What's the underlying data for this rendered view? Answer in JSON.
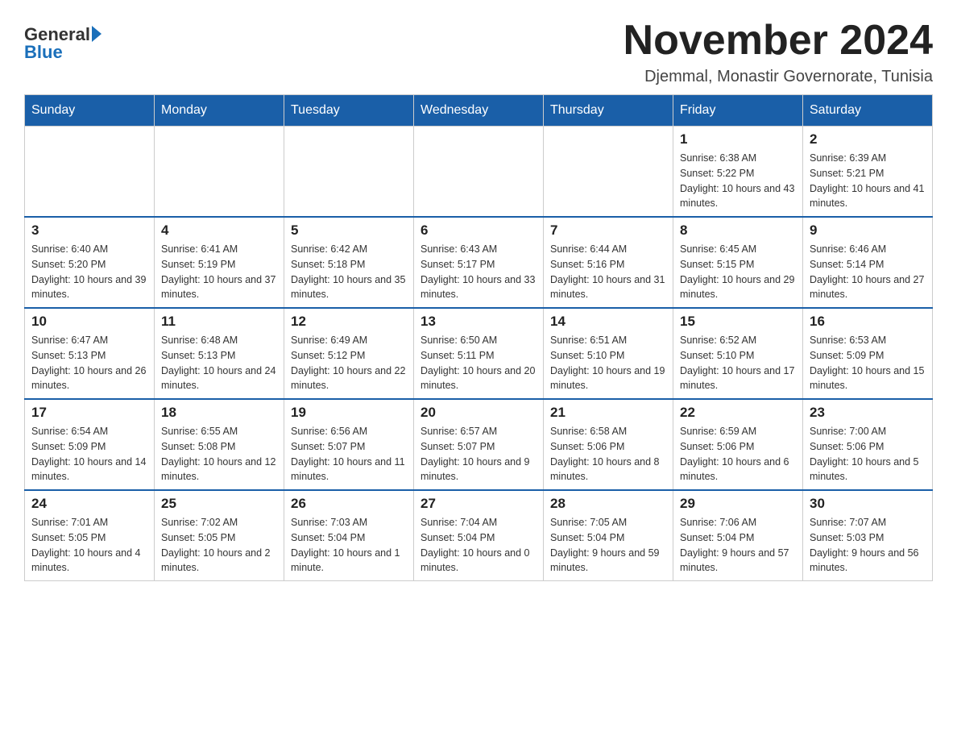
{
  "header": {
    "logo_general": "General",
    "logo_blue": "Blue",
    "title": "November 2024",
    "subtitle": "Djemmal, Monastir Governorate, Tunisia"
  },
  "weekdays": [
    "Sunday",
    "Monday",
    "Tuesday",
    "Wednesday",
    "Thursday",
    "Friday",
    "Saturday"
  ],
  "weeks": [
    [
      {
        "day": "",
        "info": ""
      },
      {
        "day": "",
        "info": ""
      },
      {
        "day": "",
        "info": ""
      },
      {
        "day": "",
        "info": ""
      },
      {
        "day": "",
        "info": ""
      },
      {
        "day": "1",
        "info": "Sunrise: 6:38 AM\nSunset: 5:22 PM\nDaylight: 10 hours and 43 minutes."
      },
      {
        "day": "2",
        "info": "Sunrise: 6:39 AM\nSunset: 5:21 PM\nDaylight: 10 hours and 41 minutes."
      }
    ],
    [
      {
        "day": "3",
        "info": "Sunrise: 6:40 AM\nSunset: 5:20 PM\nDaylight: 10 hours and 39 minutes."
      },
      {
        "day": "4",
        "info": "Sunrise: 6:41 AM\nSunset: 5:19 PM\nDaylight: 10 hours and 37 minutes."
      },
      {
        "day": "5",
        "info": "Sunrise: 6:42 AM\nSunset: 5:18 PM\nDaylight: 10 hours and 35 minutes."
      },
      {
        "day": "6",
        "info": "Sunrise: 6:43 AM\nSunset: 5:17 PM\nDaylight: 10 hours and 33 minutes."
      },
      {
        "day": "7",
        "info": "Sunrise: 6:44 AM\nSunset: 5:16 PM\nDaylight: 10 hours and 31 minutes."
      },
      {
        "day": "8",
        "info": "Sunrise: 6:45 AM\nSunset: 5:15 PM\nDaylight: 10 hours and 29 minutes."
      },
      {
        "day": "9",
        "info": "Sunrise: 6:46 AM\nSunset: 5:14 PM\nDaylight: 10 hours and 27 minutes."
      }
    ],
    [
      {
        "day": "10",
        "info": "Sunrise: 6:47 AM\nSunset: 5:13 PM\nDaylight: 10 hours and 26 minutes."
      },
      {
        "day": "11",
        "info": "Sunrise: 6:48 AM\nSunset: 5:13 PM\nDaylight: 10 hours and 24 minutes."
      },
      {
        "day": "12",
        "info": "Sunrise: 6:49 AM\nSunset: 5:12 PM\nDaylight: 10 hours and 22 minutes."
      },
      {
        "day": "13",
        "info": "Sunrise: 6:50 AM\nSunset: 5:11 PM\nDaylight: 10 hours and 20 minutes."
      },
      {
        "day": "14",
        "info": "Sunrise: 6:51 AM\nSunset: 5:10 PM\nDaylight: 10 hours and 19 minutes."
      },
      {
        "day": "15",
        "info": "Sunrise: 6:52 AM\nSunset: 5:10 PM\nDaylight: 10 hours and 17 minutes."
      },
      {
        "day": "16",
        "info": "Sunrise: 6:53 AM\nSunset: 5:09 PM\nDaylight: 10 hours and 15 minutes."
      }
    ],
    [
      {
        "day": "17",
        "info": "Sunrise: 6:54 AM\nSunset: 5:09 PM\nDaylight: 10 hours and 14 minutes."
      },
      {
        "day": "18",
        "info": "Sunrise: 6:55 AM\nSunset: 5:08 PM\nDaylight: 10 hours and 12 minutes."
      },
      {
        "day": "19",
        "info": "Sunrise: 6:56 AM\nSunset: 5:07 PM\nDaylight: 10 hours and 11 minutes."
      },
      {
        "day": "20",
        "info": "Sunrise: 6:57 AM\nSunset: 5:07 PM\nDaylight: 10 hours and 9 minutes."
      },
      {
        "day": "21",
        "info": "Sunrise: 6:58 AM\nSunset: 5:06 PM\nDaylight: 10 hours and 8 minutes."
      },
      {
        "day": "22",
        "info": "Sunrise: 6:59 AM\nSunset: 5:06 PM\nDaylight: 10 hours and 6 minutes."
      },
      {
        "day": "23",
        "info": "Sunrise: 7:00 AM\nSunset: 5:06 PM\nDaylight: 10 hours and 5 minutes."
      }
    ],
    [
      {
        "day": "24",
        "info": "Sunrise: 7:01 AM\nSunset: 5:05 PM\nDaylight: 10 hours and 4 minutes."
      },
      {
        "day": "25",
        "info": "Sunrise: 7:02 AM\nSunset: 5:05 PM\nDaylight: 10 hours and 2 minutes."
      },
      {
        "day": "26",
        "info": "Sunrise: 7:03 AM\nSunset: 5:04 PM\nDaylight: 10 hours and 1 minute."
      },
      {
        "day": "27",
        "info": "Sunrise: 7:04 AM\nSunset: 5:04 PM\nDaylight: 10 hours and 0 minutes."
      },
      {
        "day": "28",
        "info": "Sunrise: 7:05 AM\nSunset: 5:04 PM\nDaylight: 9 hours and 59 minutes."
      },
      {
        "day": "29",
        "info": "Sunrise: 7:06 AM\nSunset: 5:04 PM\nDaylight: 9 hours and 57 minutes."
      },
      {
        "day": "30",
        "info": "Sunrise: 7:07 AM\nSunset: 5:03 PM\nDaylight: 9 hours and 56 minutes."
      }
    ]
  ]
}
